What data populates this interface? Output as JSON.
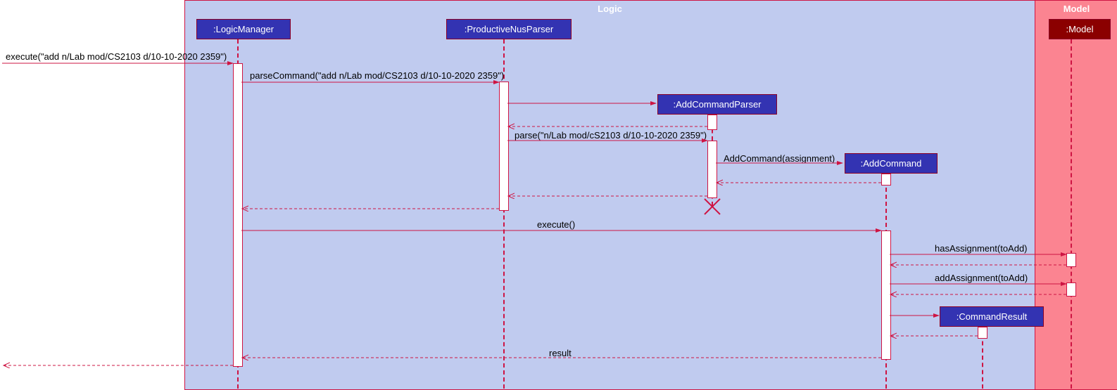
{
  "frames": {
    "logic": "Logic",
    "model": "Model"
  },
  "participants": {
    "logicManager": ":LogicManager",
    "productiveNusParser": ":ProductiveNusParser",
    "addCommandParser": ":AddCommandParser",
    "addCommand": ":AddCommand",
    "commandResult": ":CommandResult",
    "model": ":Model"
  },
  "messages": {
    "execute_in": "execute(\"add n/Lab mod/CS2103 d/10-10-2020 2359\")",
    "parseCommand": "parseCommand(\"add n/Lab mod/CS2103 d/10-10-2020 2359\")",
    "parse": "parse(\"n/Lab mod/cS2103 d/10-10-2020 2359\")",
    "addCommand": "AddCommand(assignment)",
    "execute": "execute()",
    "hasAssignment": "hasAssignment(toAdd)",
    "addAssignment": "addAssignment(toAdd)",
    "result": "result"
  }
}
